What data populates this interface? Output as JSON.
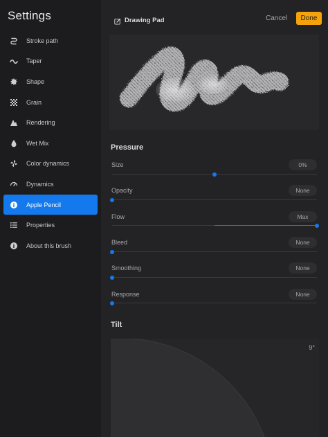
{
  "sidebar": {
    "title": "Settings",
    "items": [
      {
        "label": "Stroke path",
        "icon": "stroke-path-icon",
        "active": false
      },
      {
        "label": "Taper",
        "icon": "taper-icon",
        "active": false
      },
      {
        "label": "Shape",
        "icon": "shape-icon",
        "active": false
      },
      {
        "label": "Grain",
        "icon": "grain-icon",
        "active": false
      },
      {
        "label": "Rendering",
        "icon": "rendering-icon",
        "active": false
      },
      {
        "label": "Wet Mix",
        "icon": "wet-mix-icon",
        "active": false
      },
      {
        "label": "Color dynamics",
        "icon": "color-dynamics-icon",
        "active": false
      },
      {
        "label": "Dynamics",
        "icon": "dynamics-icon",
        "active": false
      },
      {
        "label": "Apple Pencil",
        "icon": "info-icon",
        "active": true
      },
      {
        "label": "Properties",
        "icon": "list-icon",
        "active": false
      },
      {
        "label": "About this brush",
        "icon": "info-icon",
        "active": false
      }
    ]
  },
  "header": {
    "title": "Drawing Pad",
    "icon": "edit-icon",
    "cancel_label": "Cancel",
    "done_label": "Done"
  },
  "pressure": {
    "title": "Pressure",
    "rows": [
      {
        "label": "Size",
        "value": "0%",
        "level": 0.5,
        "fill_from": 0.5,
        "fill_to": 0.5
      },
      {
        "label": "Opacity",
        "value": "None",
        "level": 0,
        "fill_from": 0,
        "fill_to": 0
      },
      {
        "label": "Flow",
        "value": "Max",
        "level": 1,
        "fill_from": 0.5,
        "fill_to": 1
      },
      {
        "label": "Bleed",
        "value": "None",
        "level": 0,
        "fill_from": 0,
        "fill_to": 0
      },
      {
        "label": "Smoothing",
        "value": "None",
        "level": 0,
        "fill_from": 0,
        "fill_to": 0
      },
      {
        "label": "Response",
        "value": "None",
        "level": 0,
        "fill_from": 0,
        "fill_to": 0
      }
    ]
  },
  "tilt": {
    "title": "Tilt",
    "value": "9°"
  },
  "colors": {
    "accent": "#1479ed",
    "done_button": "#f5a30c"
  }
}
